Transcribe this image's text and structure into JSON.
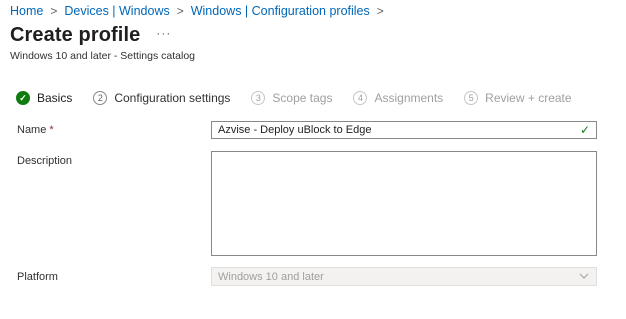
{
  "breadcrumb": {
    "items": [
      "Home",
      "Devices | Windows",
      "Windows | Configuration profiles"
    ]
  },
  "header": {
    "title": "Create profile",
    "more_icon": "ellipsis-icon",
    "subtitle": "Windows 10 and later - Settings catalog"
  },
  "steps": [
    {
      "label": "Basics",
      "number": "✓",
      "state": "completed"
    },
    {
      "label": "Configuration settings",
      "number": "2",
      "state": "enabled"
    },
    {
      "label": "Scope tags",
      "number": "3",
      "state": "disabled"
    },
    {
      "label": "Assignments",
      "number": "4",
      "state": "disabled"
    },
    {
      "label": "Review + create",
      "number": "5",
      "state": "disabled"
    }
  ],
  "form": {
    "name_label": "Name",
    "required_marker": "*",
    "name_value": "Azvise - Deploy uBlock to Edge",
    "description_label": "Description",
    "description_value": "",
    "platform_label": "Platform",
    "platform_value": "Windows 10 and later"
  },
  "colors": {
    "link": "#0067b8",
    "success": "#107c10",
    "required": "#a4262c",
    "disabled_text": "#a19f9d"
  }
}
